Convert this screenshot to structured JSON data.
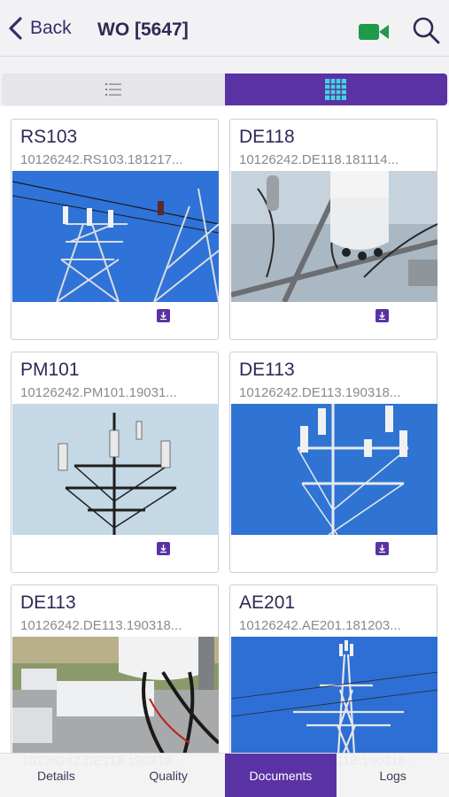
{
  "header": {
    "back_label": "Back",
    "title": "WO [5647]"
  },
  "toggle": {
    "active": "grid"
  },
  "cards": [
    {
      "title": "RS103",
      "filename": "10126242.RS103.181217...",
      "download_icon": "download-icon"
    },
    {
      "title": "DE118",
      "filename": "10126242.DE118.181114...",
      "download_icon": "download-icon"
    },
    {
      "title": "PM101",
      "filename": "10126242.PM101.19031...",
      "download_icon": "download-icon"
    },
    {
      "title": "DE113",
      "filename": "10126242.DE113.190318...",
      "download_icon": "download-icon"
    },
    {
      "title": "DE113",
      "filename": "10126242.DE113.190318...",
      "download_icon": "download-icon"
    },
    {
      "title": "AE201",
      "filename": "10126242.AE201.181203...",
      "download_icon": "download-icon"
    }
  ],
  "partial_row": [
    "10126242.DE118.190318...",
    "118.190318..."
  ],
  "tabs": [
    {
      "label": "Details"
    },
    {
      "label": "Quality"
    },
    {
      "label": "Documents",
      "active": true
    },
    {
      "label": "Logs"
    }
  ],
  "colors": {
    "accent": "#5b32a3",
    "video": "#1f9a4a",
    "title": "#2e2a55"
  }
}
